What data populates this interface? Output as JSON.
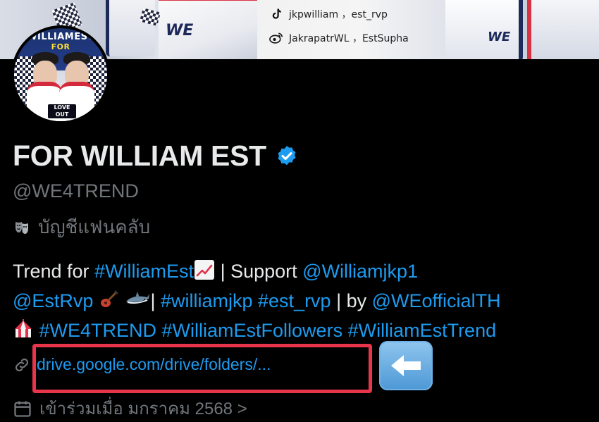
{
  "banner": {
    "social": [
      {
        "icon": "tiktok-icon",
        "text": "jkpwilliam ，est_rvp"
      },
      {
        "icon": "weibo-icon",
        "text": "JakrapatrWL ，EstSupha"
      }
    ],
    "avatar_title": "WILLIAMEST",
    "avatar_for": "FOR",
    "avatar_logo": "LOVE OUT LOUD"
  },
  "profile": {
    "display_name": "FOR WILLIAM EST",
    "handle": "@WE4TREND",
    "affiliation_label": "บัญชีแฟนคลับ"
  },
  "bio": {
    "line1_prefix": "Trend for ",
    "line1_tag": "#WilliamEst",
    "line1_sep": " | Support ",
    "line1_mention": "@Williamjkp1",
    "line2_mention": "@EstRvp",
    "line2_sep": "| ",
    "line2_tags": "#williamjkp #est_rvp",
    "line2_by": " | by ",
    "line2_mention2": "@WEofficialTH",
    "line3_tags": " #WE4TREND #WilliamEstFollowers #WilliamEstTrend"
  },
  "url": {
    "text": "drive.google.com/drive/folders/..."
  },
  "joined": {
    "text": "เข้าร่วมเมื่อ มกราคม 2568 >"
  },
  "colors": {
    "background": "#000000",
    "text": "#e7e9ea",
    "muted": "#71767b",
    "link": "#1d9bf0",
    "highlight": "#e8354a"
  }
}
